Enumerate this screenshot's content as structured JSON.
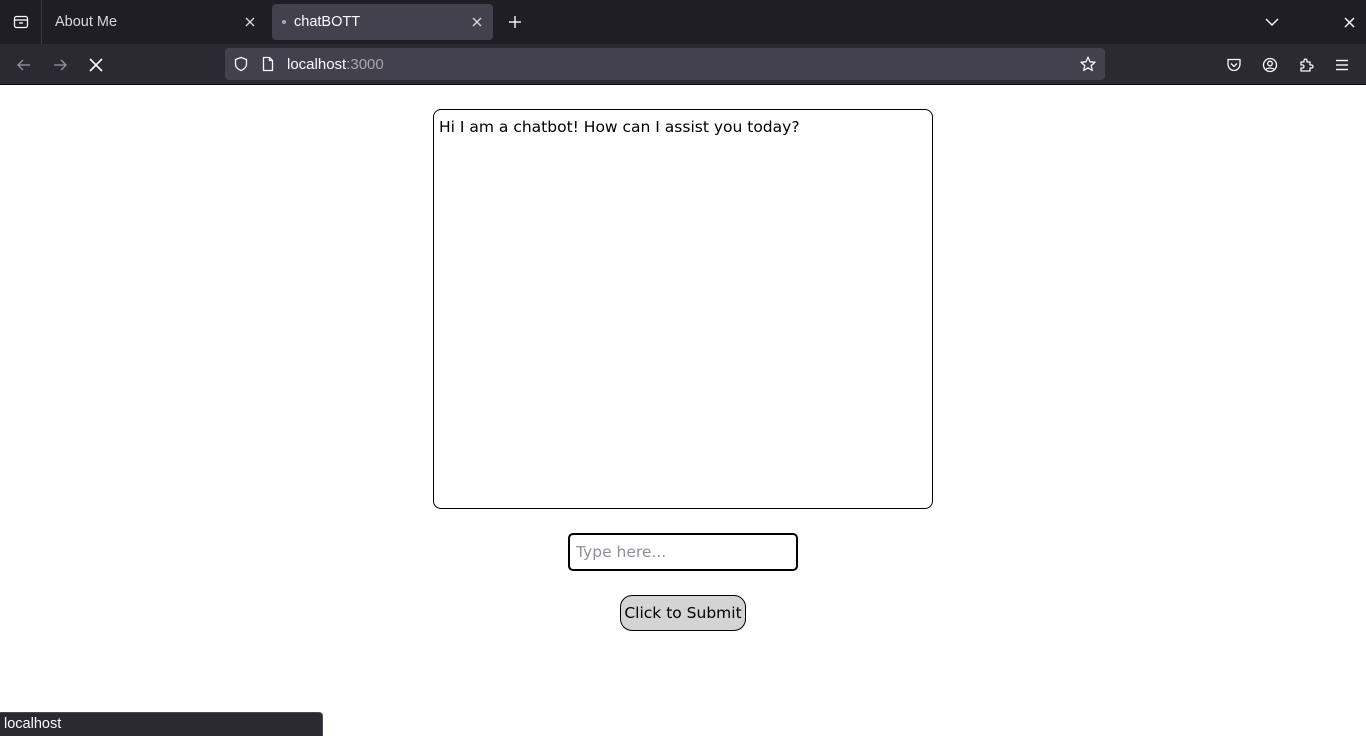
{
  "browser": {
    "tabs": [
      {
        "title": "About Me",
        "active": false
      },
      {
        "title": "chatBOTT",
        "active": true
      }
    ],
    "url": {
      "host": "localhost",
      "port": ":3000"
    },
    "status_text": "localhost"
  },
  "chat": {
    "messages": [
      "Hi I am a chatbot! How can I assist you today?"
    ],
    "input_placeholder": "Type here...",
    "input_value": "",
    "submit_label": "Click to Submit"
  },
  "colors": {
    "tabstrip_bg": "#1f1e25",
    "toolbar_bg": "#2b2a33",
    "urlbar_bg": "#42414d",
    "button_bg": "#d4d4d4"
  }
}
